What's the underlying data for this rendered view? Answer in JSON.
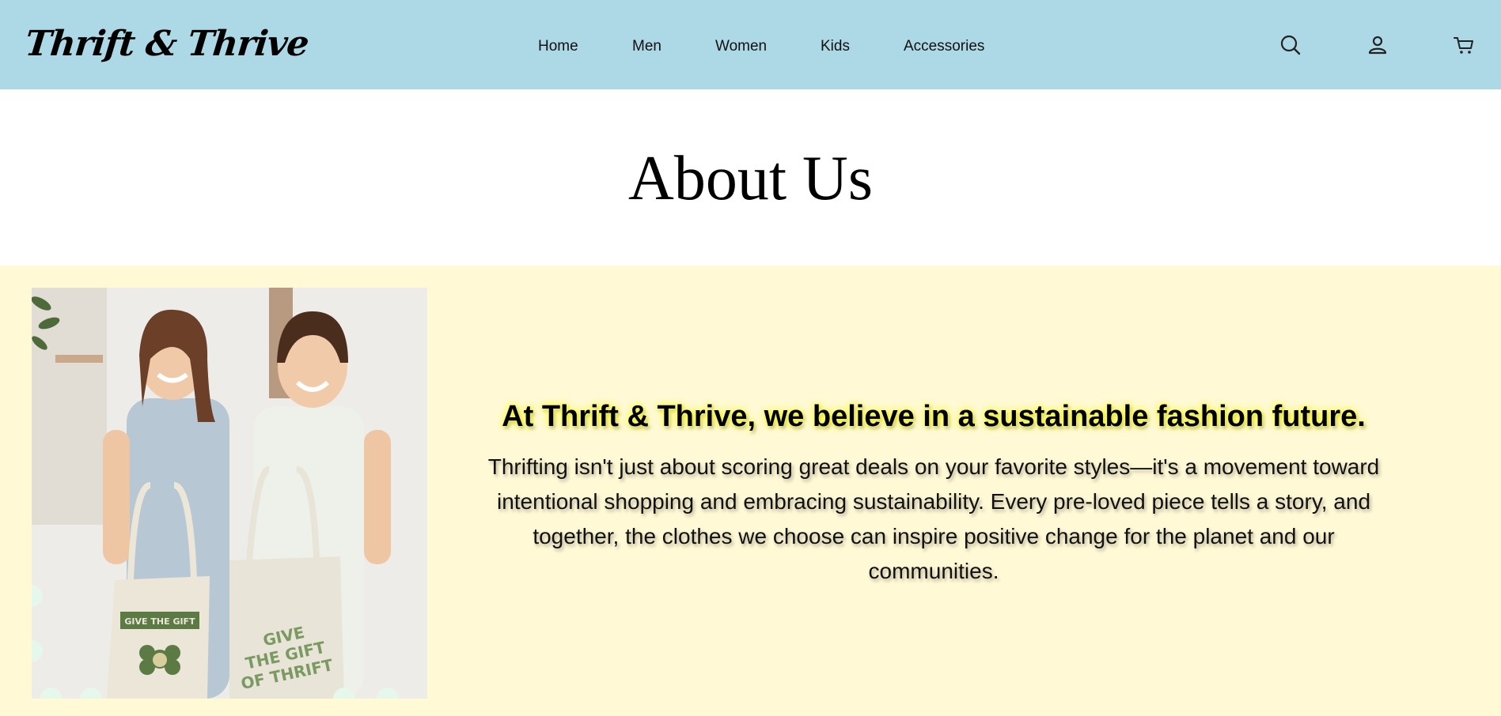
{
  "header": {
    "logo": "Thrift & Thrive",
    "nav": [
      {
        "label": "Home"
      },
      {
        "label": "Men"
      },
      {
        "label": "Women"
      },
      {
        "label": "Kids"
      },
      {
        "label": "Accessories"
      }
    ],
    "icons": [
      "search-icon",
      "user-icon",
      "cart-icon"
    ],
    "background": "#add8e6"
  },
  "page": {
    "title": "About Us"
  },
  "about": {
    "heading": "At Thrift & Thrive, we believe in a sustainable fashion future.",
    "body": "Thrifting isn't just about scoring great deals on your favorite styles—it's a movement toward intentional shopping and embracing sustainability. Every pre-loved piece tells a story, and together, the clothes we choose can inspire positive change for the planet and our communities.",
    "photo_bag_left": "GIVE THE GIFT",
    "photo_bag_right": "GIVE THE GIFT OF THRIFT",
    "background": "#fff9d6",
    "heading_glow": "#ffff00"
  }
}
